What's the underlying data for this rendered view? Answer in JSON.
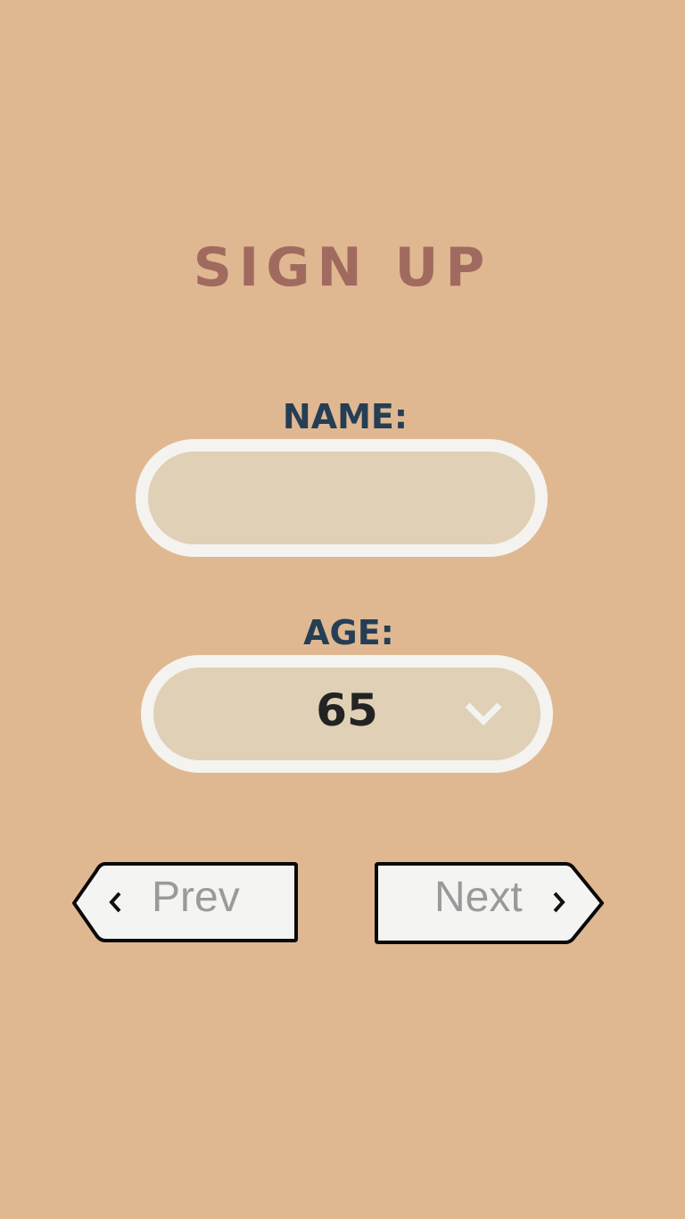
{
  "page": {
    "title": "SIGN UP"
  },
  "form": {
    "name": {
      "label": "NAME:",
      "value": "",
      "placeholder": ""
    },
    "age": {
      "label": "AGE:",
      "selected": "65"
    }
  },
  "nav": {
    "prev_label": "Prev",
    "next_label": "Next"
  },
  "icons": {
    "age_dropdown": "chevron-down-icon",
    "prev": "chevron-left-icon",
    "next": "chevron-right-icon"
  },
  "colors": {
    "background": "#dfb892",
    "title": "#a16a5f",
    "label": "#253e55",
    "field_fill": "#dfd0b6",
    "field_border": "#f4f3ef",
    "button_fill": "#f4f4f2",
    "button_text": "#9a9a9a"
  }
}
